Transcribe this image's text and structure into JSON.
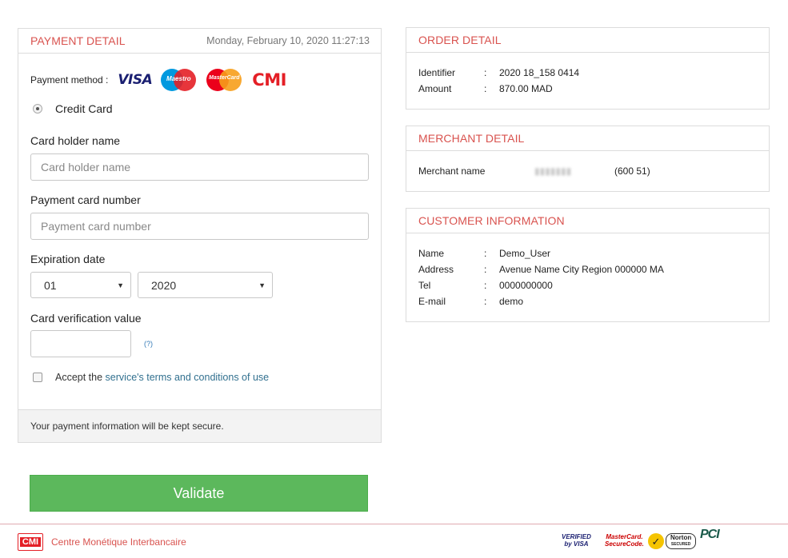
{
  "payment": {
    "title": "PAYMENT DETAIL",
    "datetime": "Monday, February 10, 2020 11:27:13",
    "method_label": "Payment method :",
    "logos": {
      "visa": "VISA",
      "maestro": "Maestro",
      "mastercard": "MasterCard",
      "cmi": "CMI"
    },
    "option_credit_card": "Credit Card",
    "card_holder_label": "Card holder name",
    "card_holder_placeholder": "Card holder name",
    "card_number_label": "Payment card number",
    "card_number_placeholder": "Payment card number",
    "expiration_label": "Expiration date",
    "exp_month": "01",
    "exp_year": "2020",
    "cvv_label": "Card verification value",
    "cvv_help": "(?)",
    "terms_prefix": "Accept the ",
    "terms_link": "service's terms and conditions of use",
    "secure_note": "Your payment information will be kept secure."
  },
  "validate_label": "Validate",
  "order": {
    "title": "ORDER DETAIL",
    "identifier_label": "Identifier",
    "identifier_value": "2020   18_158   0414",
    "amount_label": "Amount",
    "amount_value": "870.00 MAD"
  },
  "merchant": {
    "title": "MERCHANT DETAIL",
    "name_label": "Merchant name",
    "name_value": "(600     51)"
  },
  "customer": {
    "title": "CUSTOMER INFORMATION",
    "name_label": "Name",
    "name_value": "Demo_User",
    "address_label": "Address",
    "address_value": "Avenue Name City Region 000000 MA",
    "tel_label": "Tel",
    "tel_value": "0000000000",
    "email_label": "E-mail",
    "email_value": "demo"
  },
  "separator": ":",
  "footer": {
    "logo_text": "CMI",
    "org_name": "Centre Monétique Interbancaire",
    "badges": {
      "verified_visa_1": "VERIFIED",
      "verified_visa_2": "by VISA",
      "mc_secure_1": "MasterCard.",
      "mc_secure_2": "SecureCode.",
      "norton_1": "Norton",
      "norton_2": "SECURED",
      "pci": "PCI"
    }
  },
  "colors": {
    "accent_red": "#d9534f",
    "validate_green": "#5cb85c",
    "link_blue": "#31708f"
  }
}
